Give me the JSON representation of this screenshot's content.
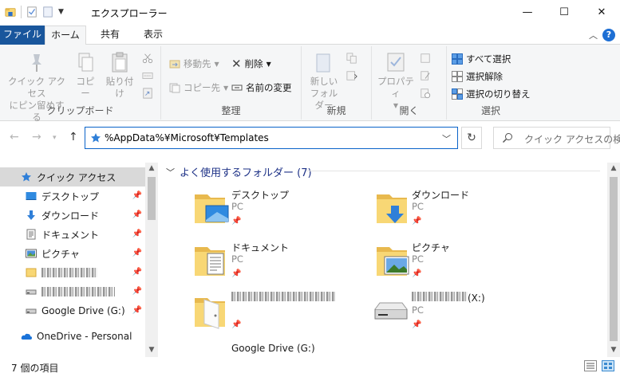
{
  "window": {
    "title": "エクスプローラー",
    "minimize_glyph": "—",
    "maximize_glyph": "☐",
    "close_glyph": "✕"
  },
  "ribbon_tabs": {
    "file": "ファイル",
    "home": "ホーム",
    "share": "共有",
    "view": "表示"
  },
  "ribbon": {
    "clipboard": {
      "group_label": "クリップボード",
      "pin_line1": "クイック アクセス",
      "pin_line2": "にピン留めする",
      "copy": "コピー",
      "paste": "貼り付け"
    },
    "organize": {
      "group_label": "整理",
      "move_to": "移動先",
      "copy_to": "コピー先",
      "delete": "削除",
      "rename": "名前の変更"
    },
    "new": {
      "group_label": "新規",
      "new_folder_line1": "新しい",
      "new_folder_line2": "フォルダー"
    },
    "open": {
      "group_label": "開く",
      "properties": "プロパティ"
    },
    "select": {
      "group_label": "選択",
      "select_all": "すべて選択",
      "select_none": "選択解除",
      "invert": "選択の切り替え"
    }
  },
  "address": {
    "path": "%AppData%¥Microsoft¥Templates",
    "search_placeholder": "クイック アクセスの検..."
  },
  "nav_pane": {
    "quick_access": "クイック アクセス",
    "desktop": "デスクトップ",
    "downloads": "ダウンロード",
    "documents": "ドキュメント",
    "pictures": "ピクチャ",
    "google_drive": "Google Drive (G:)",
    "onedrive": "OneDrive - Personal"
  },
  "content": {
    "section_title": "よく使用するフォルダー (7)",
    "tiles": [
      {
        "name": "デスクトップ",
        "sub": "PC"
      },
      {
        "name": "ダウンロード",
        "sub": "PC"
      },
      {
        "name": "ドキュメント",
        "sub": "PC"
      },
      {
        "name": "ピクチャ",
        "sub": "PC"
      },
      {
        "name": "",
        "sub": ""
      },
      {
        "name": "(X:)",
        "sub": "PC"
      },
      {
        "name": "Google Drive (G:)",
        "sub": ""
      }
    ]
  },
  "status": {
    "item_count": "7 個の項目"
  },
  "colors": {
    "file_tab": "#19569c",
    "accent": "#0a63c9",
    "section_header": "#1e3287",
    "folder_yellow": "#f8d775",
    "selection": "#d9d9d9"
  }
}
